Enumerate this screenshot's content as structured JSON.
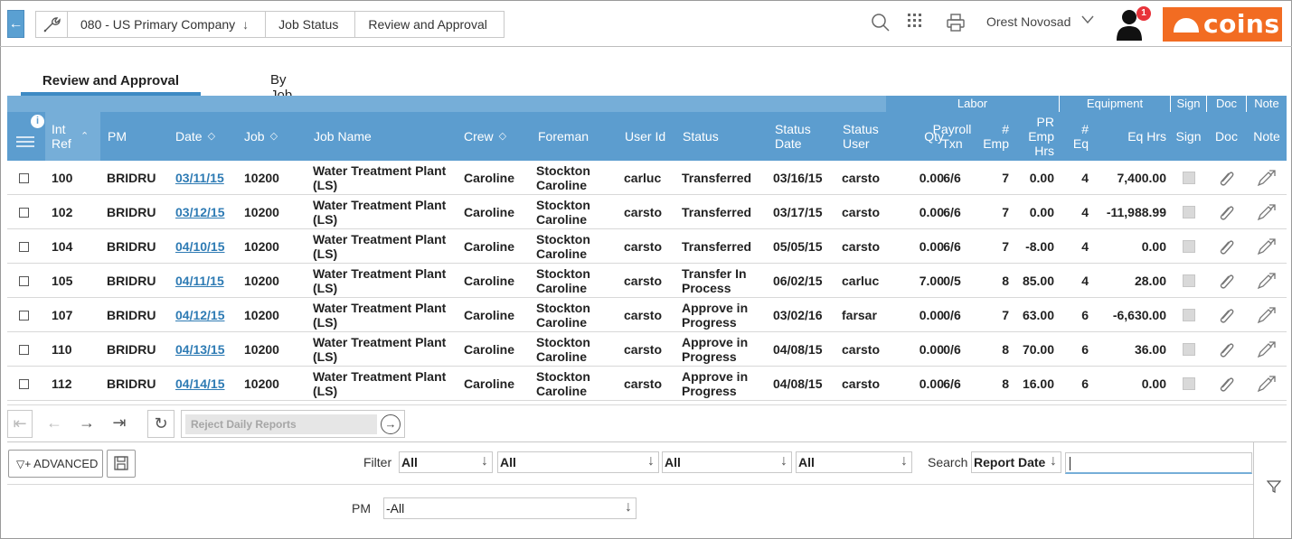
{
  "breadcrumbs": [
    {
      "label": "080 - US Primary Company",
      "has_dropdown": true
    },
    {
      "label": "Job Status"
    },
    {
      "label": "Review and Approval"
    }
  ],
  "user": {
    "name": "Orest Novosad",
    "notifications": "1"
  },
  "brand": {
    "logo_text": "coins",
    "color": "#f26c22"
  },
  "tabs": [
    {
      "label": "Review and Approval",
      "active": true
    },
    {
      "label": "By Job",
      "active": false
    }
  ],
  "header_groups": {
    "labor": "Labor",
    "equipment": "Equipment",
    "sign": "Sign",
    "doc": "Doc",
    "note": "Note"
  },
  "columns": {
    "int_ref": "Int Ref",
    "pm": "PM",
    "date": "Date",
    "job": "Job",
    "job_name": "Job Name",
    "crew": "Crew",
    "foreman": "Foreman",
    "user_id": "User Id",
    "status": "Status",
    "status_date": "Status Date",
    "status_user": "Status User",
    "qty": "Qty",
    "payroll_txn": "Payroll Txn",
    "emp": "# Emp",
    "pr_emp_hrs": "PR Emp Hrs",
    "eq": "# Eq",
    "eq_hrs": "Eq Hrs",
    "sign": "Sign",
    "doc": "Doc",
    "note": "Note"
  },
  "rows": [
    {
      "int_ref": "100",
      "pm": "BRIDRU",
      "date": "03/11/15",
      "job": "10200",
      "job_name": "Water Treatment Plant (LS)",
      "crew": "Caroline",
      "foreman": "Stockton Caroline",
      "user_id": "carluc",
      "status": "Transferred",
      "status_date": "03/16/15",
      "status_user": "carsto",
      "qty": "0.00",
      "payroll_txn": "6/6",
      "emp": "7",
      "pr_emp_hrs": "0.00",
      "eq": "4",
      "eq_hrs": "7,400.00"
    },
    {
      "int_ref": "102",
      "pm": "BRIDRU",
      "date": "03/12/15",
      "job": "10200",
      "job_name": "Water Treatment Plant (LS)",
      "crew": "Caroline",
      "foreman": "Stockton Caroline",
      "user_id": "carsto",
      "status": "Transferred",
      "status_date": "03/17/15",
      "status_user": "carsto",
      "qty": "0.00",
      "payroll_txn": "6/6",
      "emp": "7",
      "pr_emp_hrs": "0.00",
      "eq": "4",
      "eq_hrs": "-11,988.99"
    },
    {
      "int_ref": "104",
      "pm": "BRIDRU",
      "date": "04/10/15",
      "job": "10200",
      "job_name": "Water Treatment Plant (LS)",
      "crew": "Caroline",
      "foreman": "Stockton Caroline",
      "user_id": "carsto",
      "status": "Transferred",
      "status_date": "05/05/15",
      "status_user": "carsto",
      "qty": "0.00",
      "payroll_txn": "6/6",
      "emp": "7",
      "pr_emp_hrs": "-8.00",
      "eq": "4",
      "eq_hrs": "0.00"
    },
    {
      "int_ref": "105",
      "pm": "BRIDRU",
      "date": "04/11/15",
      "job": "10200",
      "job_name": "Water Treatment Plant (LS)",
      "crew": "Caroline",
      "foreman": "Stockton Caroline",
      "user_id": "carsto",
      "status": "Transfer In Process",
      "status_date": "06/02/15",
      "status_user": "carluc",
      "qty": "7.00",
      "payroll_txn": "0/5",
      "emp": "8",
      "pr_emp_hrs": "85.00",
      "eq": "4",
      "eq_hrs": "28.00"
    },
    {
      "int_ref": "107",
      "pm": "BRIDRU",
      "date": "04/12/15",
      "job": "10200",
      "job_name": "Water Treatment Plant (LS)",
      "crew": "Caroline",
      "foreman": "Stockton Caroline",
      "user_id": "carsto",
      "status": "Approve in Progress",
      "status_date": "03/02/16",
      "status_user": "farsar",
      "qty": "0.00",
      "payroll_txn": "0/6",
      "emp": "7",
      "pr_emp_hrs": "63.00",
      "eq": "6",
      "eq_hrs": "-6,630.00"
    },
    {
      "int_ref": "110",
      "pm": "BRIDRU",
      "date": "04/13/15",
      "job": "10200",
      "job_name": "Water Treatment Plant (LS)",
      "crew": "Caroline",
      "foreman": "Stockton Caroline",
      "user_id": "carsto",
      "status": "Approve in Progress",
      "status_date": "04/08/15",
      "status_user": "carsto",
      "qty": "0.00",
      "payroll_txn": "0/6",
      "emp": "8",
      "pr_emp_hrs": "70.00",
      "eq": "6",
      "eq_hrs": "36.00"
    },
    {
      "int_ref": "112",
      "pm": "BRIDRU",
      "date": "04/14/15",
      "job": "10200",
      "job_name": "Water Treatment Plant (LS)",
      "crew": "Caroline",
      "foreman": "Stockton Caroline",
      "user_id": "carsto",
      "status": "Approve in Progress",
      "status_date": "04/08/15",
      "status_user": "carsto",
      "qty": "0.00",
      "payroll_txn": "6/6",
      "emp": "8",
      "pr_emp_hrs": "16.00",
      "eq": "6",
      "eq_hrs": "0.00"
    }
  ],
  "pager": {
    "reject_placeholder": "Reject Daily Reports"
  },
  "filters": {
    "advanced_label": "ADVANCED",
    "filter_label": "Filter",
    "filter_values": [
      "All",
      "All",
      "All",
      "All"
    ],
    "search_label": "Search",
    "search_field": "Report Date",
    "search_value": "",
    "pm_label": "PM",
    "pm_value": "-All"
  }
}
